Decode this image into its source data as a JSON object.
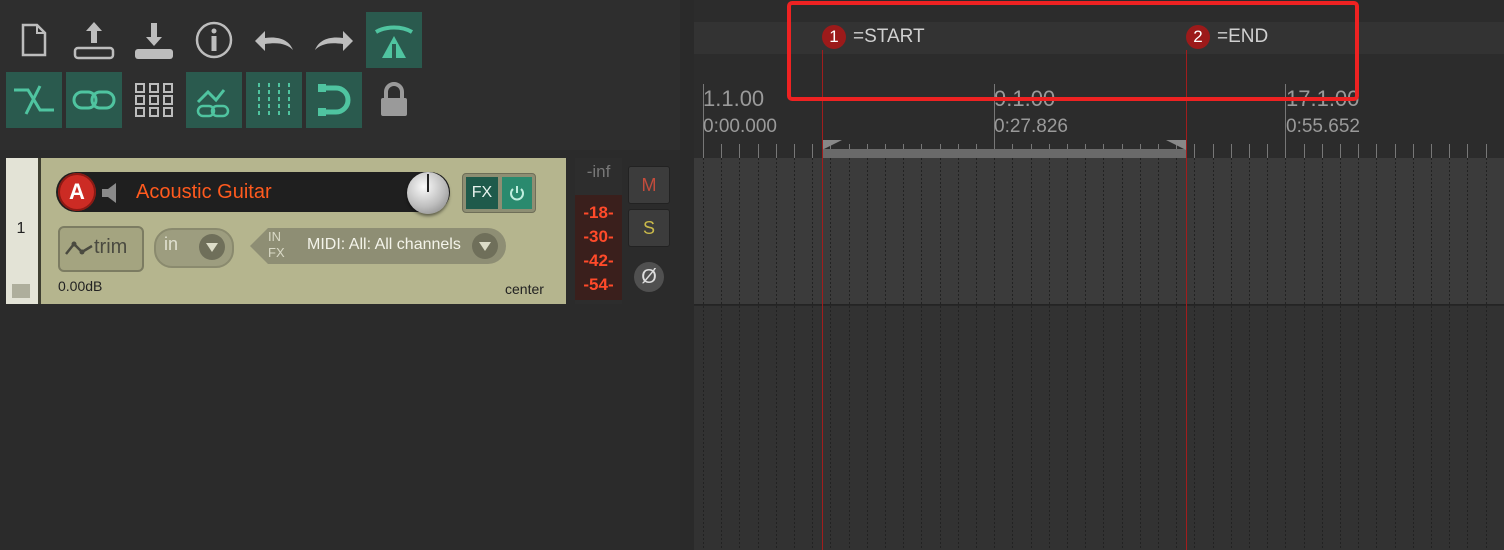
{
  "toolbar": {
    "row1": [
      {
        "name": "new-project-icon",
        "active": false
      },
      {
        "name": "open-project-icon",
        "active": false
      },
      {
        "name": "save-project-icon",
        "active": false
      },
      {
        "name": "info-icon",
        "active": false
      },
      {
        "name": "undo-icon",
        "active": false
      },
      {
        "name": "redo-icon",
        "active": false
      },
      {
        "name": "metronome-icon",
        "active": true
      }
    ],
    "row2": [
      {
        "name": "auto-crossfade-icon",
        "active": true
      },
      {
        "name": "link-icon",
        "active": true
      },
      {
        "name": "grid-icon",
        "active": false
      },
      {
        "name": "ripple-edit-icon",
        "active": true
      },
      {
        "name": "snap-grid-icon",
        "active": true
      },
      {
        "name": "loop-icon",
        "active": true
      },
      {
        "name": "lock-icon",
        "active": false
      }
    ],
    "accent_color": "#4fc4a0"
  },
  "track": {
    "number": "1",
    "name": "Acoustic Guitar",
    "arm_label": "A",
    "fx_label": "FX",
    "trim_label": "trim",
    "input_label": "in",
    "input_fx_label_top": "IN",
    "input_fx_label_bottom": "FX",
    "midi_input": "MIDI: All: All channels",
    "volume": "0.00dB",
    "pan": "center",
    "name_color": "#ff5a1e"
  },
  "meter": {
    "peak": "-inf",
    "ticks": [
      "-18-",
      "-30-",
      "-42-",
      "-54-"
    ],
    "color": "#ff4a2a"
  },
  "buttons": {
    "mute": "M",
    "solo": "S",
    "phase": "Ø"
  },
  "markers": [
    {
      "index": "1",
      "label": "=START"
    },
    {
      "index": "2",
      "label": "=END"
    }
  ],
  "ruler": [
    {
      "measure": "1.1.00",
      "time": "0:00.000"
    },
    {
      "measure": "9.1.00",
      "time": "0:27.826"
    },
    {
      "measure": "17.1.00",
      "time": "0:55.652"
    }
  ],
  "highlight_color": "#ee2222"
}
